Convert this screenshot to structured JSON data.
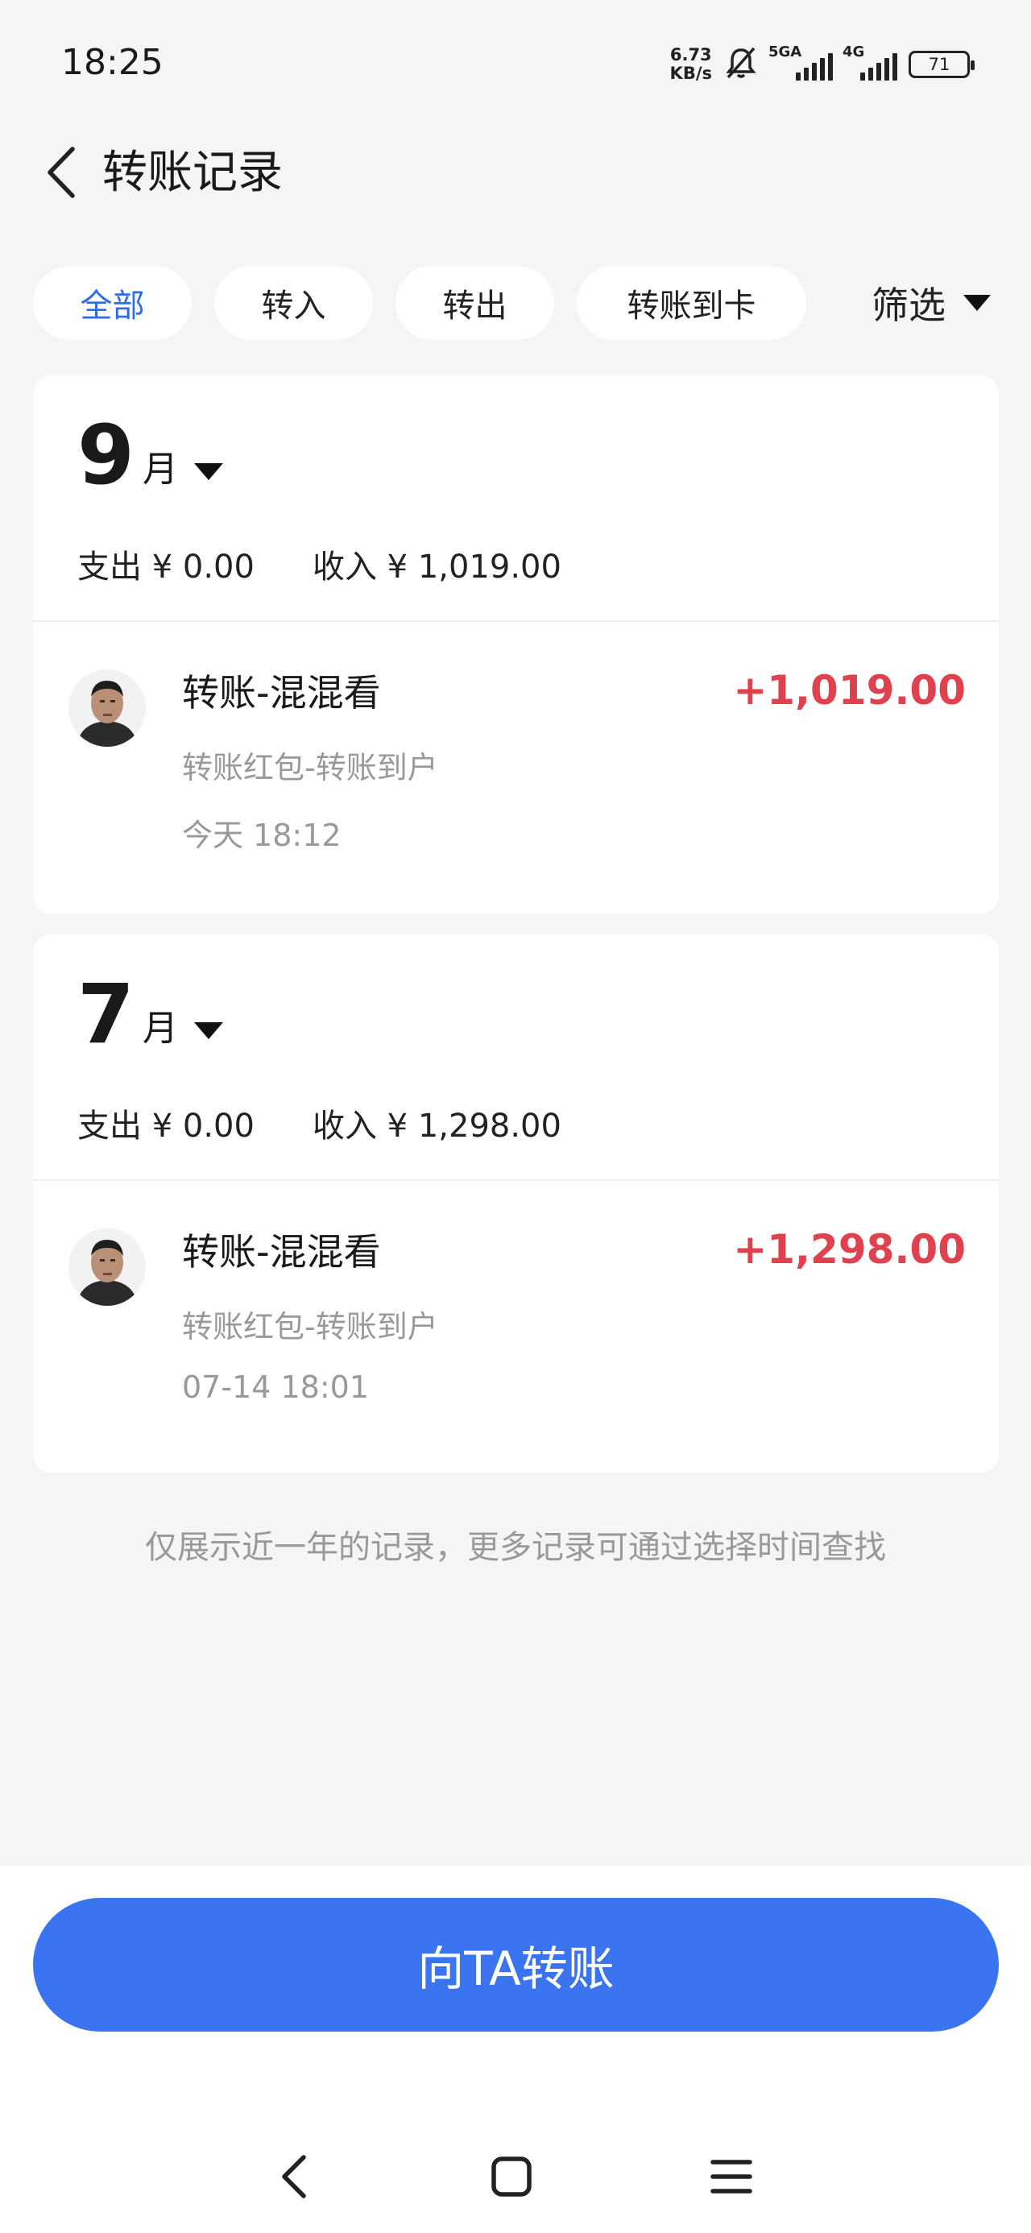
{
  "status_bar": {
    "time": "18:25",
    "net_speed_value": "6.73",
    "net_speed_unit": "KB/s",
    "sim1_label": "5GA",
    "sim2_label": "4G",
    "battery": "71",
    "icons": [
      "bell-muted-icon",
      "signal-icon",
      "battery-icon"
    ]
  },
  "header": {
    "title": "转账记录",
    "back_icon": "chevron-left-icon"
  },
  "tabs": [
    {
      "label": "全部",
      "active": true
    },
    {
      "label": "转入",
      "active": false
    },
    {
      "label": "转出",
      "active": false
    },
    {
      "label": "转账到卡",
      "active": false
    }
  ],
  "filter": {
    "label": "筛选",
    "icon": "caret-down-icon"
  },
  "months": [
    {
      "month_number": "9",
      "month_unit": "月",
      "expense": "支出 ¥ 0.00",
      "income": "收入 ¥ 1,019.00",
      "transactions": [
        {
          "title": "转账-混混看",
          "subtitle": "转账红包-转账到户",
          "time": "今天 18:12",
          "amount": "+1,019.00"
        }
      ]
    },
    {
      "month_number": "7",
      "month_unit": "月",
      "expense": "支出 ¥ 0.00",
      "income": "收入 ¥ 1,298.00",
      "transactions": [
        {
          "title": "转账-混混看",
          "subtitle": "转账红包-转账到户",
          "time": "07-14 18:01",
          "amount": "+1,298.00"
        }
      ]
    }
  ],
  "notice": "仅展示近一年的记录，更多记录可通过选择时间查找",
  "cta": {
    "label": "向TA转账"
  },
  "colors": {
    "accent": "#3a74f1",
    "tab_active": "#2f6be6",
    "amount_positive": "#e0414f",
    "background": "#f5f5f5"
  },
  "nav_bar": {
    "icons": [
      "back-nav-icon",
      "home-nav-icon",
      "menu-nav-icon"
    ]
  }
}
